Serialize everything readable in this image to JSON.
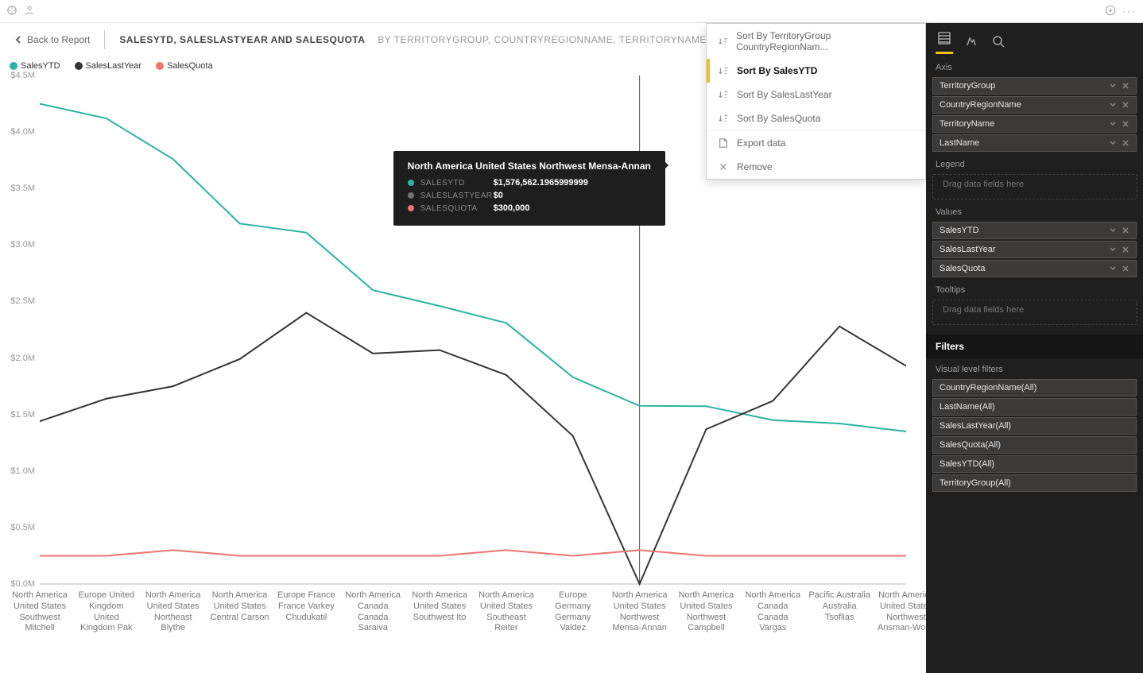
{
  "header": {
    "back": "Back to Report",
    "title_bold": "SalesYTD, SalesLastYear and SalesQuota",
    "title_sub": "by TerritoryGroup, CountryRegionName, TerritoryName and LastName"
  },
  "legend": [
    {
      "name": "SalesYTD",
      "color": "#2bb3a3"
    },
    {
      "name": "SalesLastYear",
      "color": "#353535"
    },
    {
      "name": "SalesQuota",
      "color": "#ee746f"
    }
  ],
  "tooltip": {
    "title": "North America United States Northwest Mensa-Annan",
    "rows": [
      {
        "name": "SalesYTD",
        "value": "$1,576,562.1965999999",
        "color": "#2bb3a3"
      },
      {
        "name": "SalesLastYear",
        "value": "$0",
        "color": "#6f7472"
      },
      {
        "name": "SalesQuota",
        "value": "$300,000",
        "color": "#ee746f"
      }
    ]
  },
  "context_menu": {
    "items": [
      {
        "label": "Sort By TerritoryGroup CountryRegionNam...",
        "type": "sort"
      },
      {
        "label": "Sort By SalesYTD",
        "type": "sort",
        "active": true
      },
      {
        "label": "Sort By SalesLastYear",
        "type": "sort"
      },
      {
        "label": "Sort By SalesQuota",
        "type": "sort"
      },
      {
        "label": "Export data",
        "type": "export"
      },
      {
        "label": "Remove",
        "type": "remove"
      }
    ]
  },
  "right_panel": {
    "axis_label": "Axis",
    "axis_fields": [
      "TerritoryGroup",
      "CountryRegionName",
      "TerritoryName",
      "LastName"
    ],
    "legend_label": "Legend",
    "legend_placeholder": "Drag data fields here",
    "values_label": "Values",
    "value_fields": [
      "SalesYTD",
      "SalesLastYear",
      "SalesQuota"
    ],
    "tooltips_label": "Tooltips",
    "tooltips_placeholder": "Drag data fields here",
    "filters_header": "Filters",
    "filters_sub": "Visual level filters",
    "filter_items": [
      "CountryRegionName(All)",
      "LastName(All)",
      "SalesLastYear(All)",
      "SalesQuota(All)",
      "SalesYTD(All)",
      "TerritoryGroup(All)"
    ]
  },
  "chart_data": {
    "type": "line",
    "ylabel_prefix": "$",
    "ylabel_suffix": "M",
    "ylim": [
      0,
      4.5
    ],
    "y_ticks": [
      0.0,
      0.5,
      1.0,
      1.5,
      2.0,
      2.5,
      3.0,
      3.5,
      4.0,
      4.5
    ],
    "categories": [
      "North America United States Southwest Mitchell",
      "Europe United Kingdom United Kingdom Pak",
      "North America United States Northeast Blythe",
      "North America United States Central Carson",
      "Europe France France Varkey Chudukatil",
      "North America Canada Canada Saraiva",
      "North America United States Southwest Ito",
      "North America United States Southeast Reiter",
      "Europe Germany Germany Valdez",
      "North America United States Northwest Mensa-Annan",
      "North America United States Northwest Campbell",
      "North America Canada Canada Vargas",
      "Pacific Australia Australia Tsoflias",
      "North America United States Northwest Ansman-Wol..."
    ],
    "series": [
      {
        "name": "SalesYTD",
        "color": "#2bb3a3",
        "values": [
          4.25,
          4.12,
          3.76,
          3.19,
          3.11,
          2.6,
          2.46,
          2.31,
          1.83,
          1.576562,
          1.573,
          1.45,
          1.42,
          1.35
        ]
      },
      {
        "name": "SalesLastYear",
        "color": "#353535",
        "values": [
          1.44,
          1.64,
          1.75,
          1.99,
          2.4,
          2.04,
          2.07,
          1.85,
          1.31,
          0.0,
          1.37,
          1.62,
          2.28,
          1.93
        ]
      },
      {
        "name": "SalesQuota",
        "color": "#ee746f",
        "values": [
          0.25,
          0.25,
          0.3,
          0.25,
          0.25,
          0.25,
          0.25,
          0.3,
          0.25,
          0.3,
          0.25,
          0.25,
          0.25,
          0.25
        ]
      }
    ],
    "highlight_index": 9
  }
}
